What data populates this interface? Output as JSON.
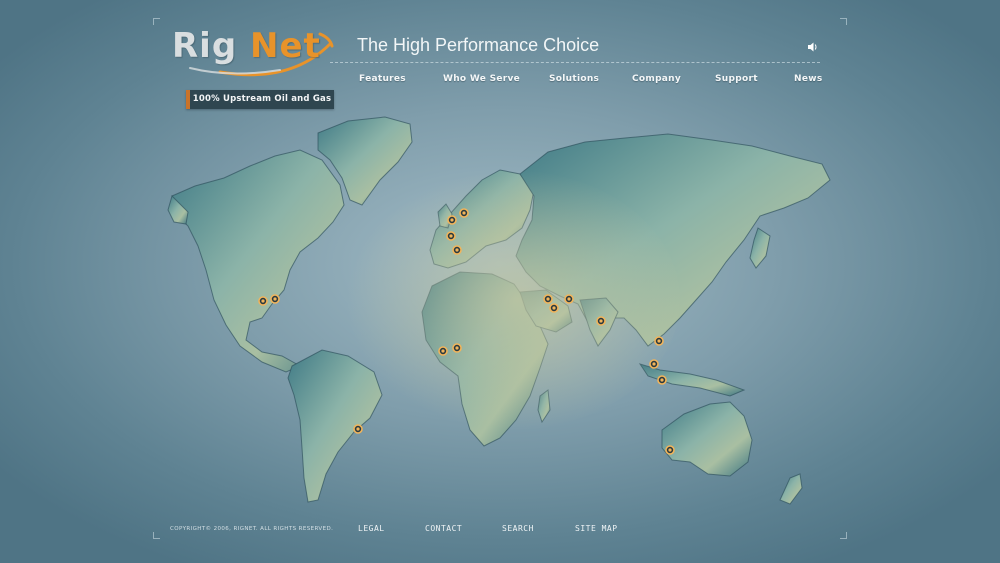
{
  "brand": {
    "logo_text_part1": "Rig",
    "logo_text_part2": "Net",
    "tagline": "The High Performance Choice",
    "accent_color": "#e8932a",
    "logo_gray": "#d9dee0"
  },
  "audio": {
    "icon": "speaker-icon"
  },
  "nav": {
    "items": [
      {
        "label": "Features"
      },
      {
        "label": "Who We Serve"
      },
      {
        "label": "Solutions"
      },
      {
        "label": "Company"
      },
      {
        "label": "Support"
      },
      {
        "label": "News"
      }
    ]
  },
  "badge": {
    "label": "100% Upstream Oil and Gas",
    "accent": "#c9732a"
  },
  "map": {
    "marker_color": "#f2b45a",
    "locations": [
      {
        "region": "houston-1"
      },
      {
        "region": "houston-2"
      },
      {
        "region": "north-sea-1"
      },
      {
        "region": "north-sea-2"
      },
      {
        "region": "aberdeen"
      },
      {
        "region": "mediterranean"
      },
      {
        "region": "west-africa-1"
      },
      {
        "region": "west-africa-2"
      },
      {
        "region": "brazil"
      },
      {
        "region": "middle-east-1"
      },
      {
        "region": "middle-east-2"
      },
      {
        "region": "middle-east-3"
      },
      {
        "region": "india"
      },
      {
        "region": "southeast-asia-1"
      },
      {
        "region": "southeast-asia-2"
      },
      {
        "region": "southeast-asia-3"
      },
      {
        "region": "australia"
      }
    ]
  },
  "footer": {
    "copyright": "COPYRIGHT© 2006, RIGNET. ALL RIGHTS RESERVED.",
    "links": [
      {
        "label": "LEGAL"
      },
      {
        "label": "CONTACT"
      },
      {
        "label": "SEARCH"
      },
      {
        "label": "SITE MAP"
      }
    ]
  }
}
